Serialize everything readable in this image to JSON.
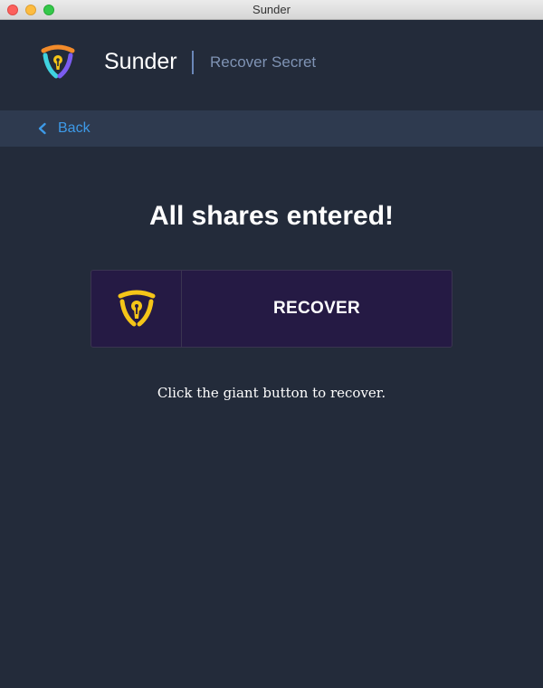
{
  "window": {
    "title": "Sunder"
  },
  "header": {
    "app_name": "Sunder",
    "page_title": "Recover Secret",
    "logo_icon": "shield-keyhole-icon"
  },
  "back": {
    "label": "Back",
    "icon": "chevron-left-icon",
    "color": "#3d9ae8"
  },
  "main": {
    "heading": "All shares entered!",
    "recover_button": {
      "label": "RECOVER",
      "icon": "shield-keyhole-icon",
      "icon_color": "#f5c518"
    },
    "hint": "Click the giant button to recover."
  },
  "colors": {
    "background": "#232b3a",
    "back_bar": "#2e3a4f",
    "button_bg": "#251a44",
    "accent_orange": "#f28b2a",
    "accent_cyan": "#3fd3e0",
    "accent_purple": "#7b5cf0"
  }
}
